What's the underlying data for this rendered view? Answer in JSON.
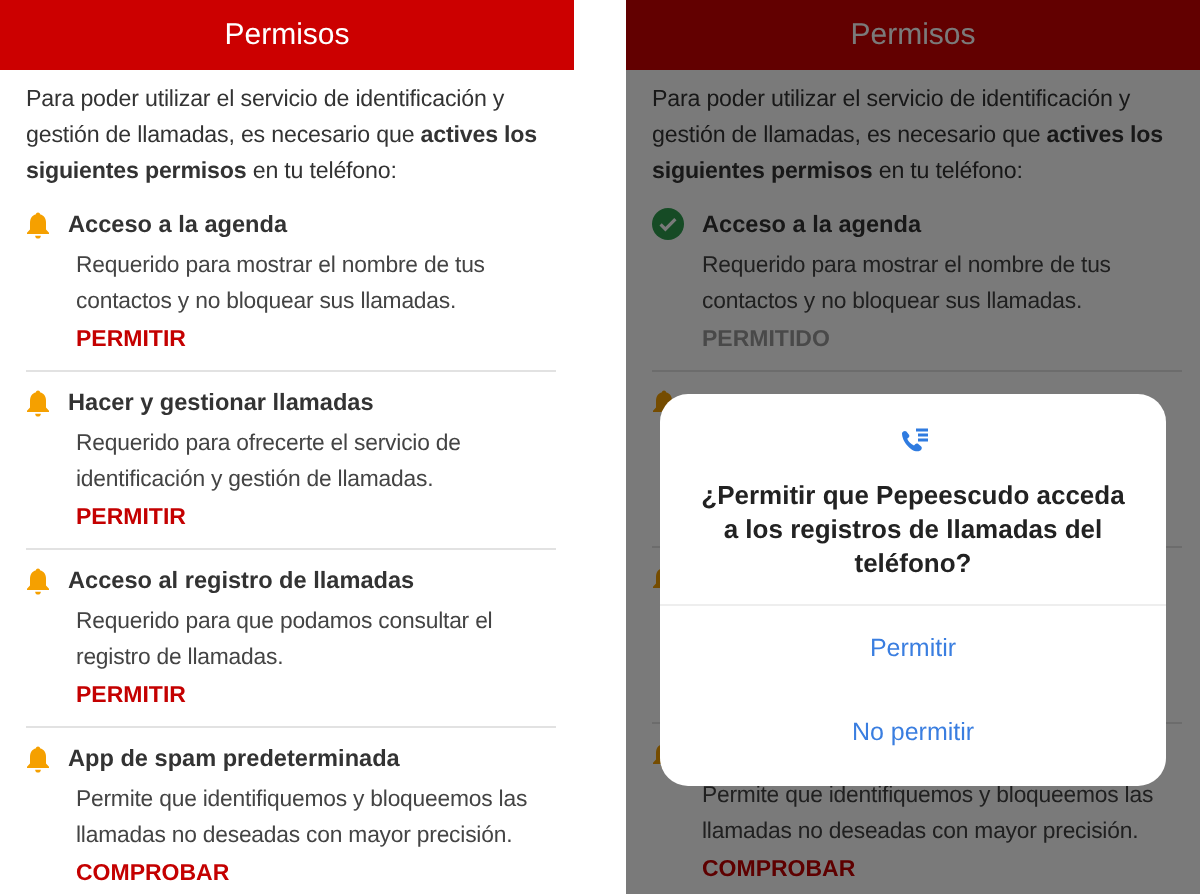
{
  "screens": [
    {
      "header": {
        "title": "Permisos"
      },
      "intro": "Para poder utilizar el servicio de identificación y gestión de llamadas, es necesario que **actives los siguientes permisos** en tu teléfono:",
      "dimmed": false,
      "items": [
        {
          "granted": false,
          "title": "Acceso a la agenda",
          "description": "Requerido para mostrar el nombre de tus contactos y no bloquear sus llamadas.",
          "action": "PERMITIR"
        },
        {
          "granted": false,
          "title": "Hacer y gestionar llamadas",
          "description": "Requerido para ofrecerte el servicio de identificación y gestión de llamadas.",
          "action": "PERMITIR"
        },
        {
          "granted": false,
          "title": "Acceso al registro de llamadas",
          "description": "Requerido para que podamos consultar el registro de llamadas.",
          "action": "PERMITIR"
        },
        {
          "granted": false,
          "title": "App de spam predeterminada",
          "description": "Permite que identifiquemos y bloqueemos las llamadas no deseadas con mayor precisión.",
          "action": "COMPROBAR"
        }
      ]
    },
    {
      "header": {
        "title": "Permisos"
      },
      "intro": "Para poder utilizar el servicio de identificación y gestión de llamadas, es necesario que **actives los siguientes permisos** en tu teléfono:",
      "dimmed": true,
      "items": [
        {
          "granted": true,
          "title": "Acceso a la agenda",
          "description": "Requerido para mostrar el nombre de tus contactos y no bloquear sus llamadas.",
          "action": "PERMITIDO"
        },
        {
          "granted": false
        },
        {
          "granted": false
        },
        {
          "granted": false,
          "description": "Permite que identifiquemos y bloqueemos las llamadas no deseadas con mayor precisión.",
          "action": "COMPROBAR"
        }
      ],
      "dialog": {
        "title": "¿Permitir que Pepeescudo acceda a los registros de llamadas del teléfono?",
        "buttons": [
          "Permitir",
          "No permitir"
        ]
      }
    }
  ]
}
